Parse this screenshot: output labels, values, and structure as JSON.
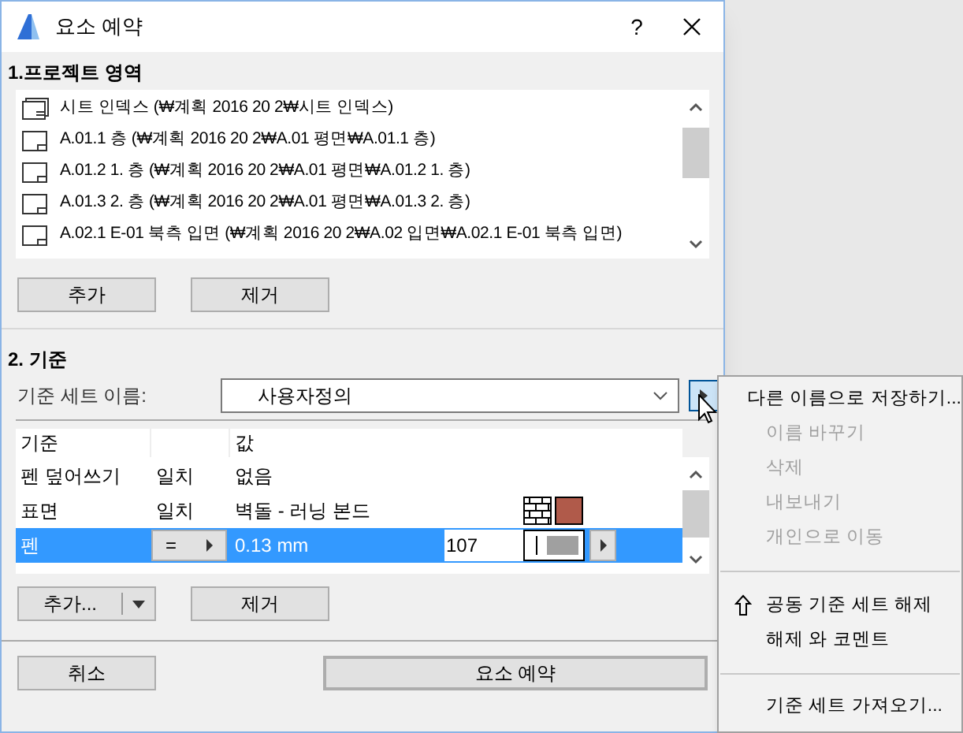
{
  "window": {
    "title": "요소 예약",
    "help": "?"
  },
  "section1": {
    "heading": "1.프로젝트 영역",
    "items": [
      {
        "label": "시트 인덱스 (₩계획 2016 20 2₩시트 인덱스)",
        "kind": "index"
      },
      {
        "label": "A.01.1 층 (₩계획 2016 20 2₩A.01 평면₩A.01.1 층)",
        "kind": "sheet"
      },
      {
        "label": "A.01.2 1. 층 (₩계획 2016 20 2₩A.01 평면₩A.01.2 1. 층)",
        "kind": "sheet"
      },
      {
        "label": "A.01.3 2. 층 (₩계획 2016 20 2₩A.01 평면₩A.01.3 2. 층)",
        "kind": "sheet"
      },
      {
        "label": "A.02.1 E-01 북측 입면 (₩계획 2016 20 2₩A.02 입면₩A.02.1 E-01 북측 입면)",
        "kind": "sheet"
      }
    ],
    "buttons": [
      "추가",
      "제거"
    ]
  },
  "section2": {
    "heading": "2. 기준",
    "set_label": "기준 세트 이름:",
    "set_value": "사용자정의",
    "columns": [
      "기준",
      "값"
    ],
    "rows": [
      {
        "criterion": "펜 덮어쓰기",
        "match": "일치",
        "value": "없음",
        "kind": "plain",
        "selected": false
      },
      {
        "criterion": "표면",
        "match": "일치",
        "value": "벽돌 - 러닝 본드",
        "kind": "surface",
        "color": "#b05a4a",
        "selected": false
      },
      {
        "criterion": "펜",
        "operator": "=",
        "value": "0.13 mm",
        "number": "107",
        "kind": "pen",
        "selected": true
      }
    ],
    "add_button": "추가...",
    "remove_button": "제거"
  },
  "footer": {
    "cancel": "취소",
    "confirm": "요소 예약"
  },
  "menu": {
    "groups": [
      [
        {
          "label": "다른 이름으로 저장하기...",
          "disabled": false
        },
        {
          "label": "이름 바꾸기",
          "disabled": true
        },
        {
          "label": "삭제",
          "disabled": true
        },
        {
          "label": "내보내기",
          "disabled": true
        },
        {
          "label": "개인으로 이동",
          "disabled": true
        }
      ],
      [
        {
          "label": "공동 기준 세트 해제",
          "disabled": false,
          "kind": "shared"
        },
        {
          "label": "해제 와 코멘트",
          "disabled": false
        }
      ],
      [
        {
          "label": "기준 세트 가져오기...",
          "disabled": false
        }
      ]
    ]
  }
}
